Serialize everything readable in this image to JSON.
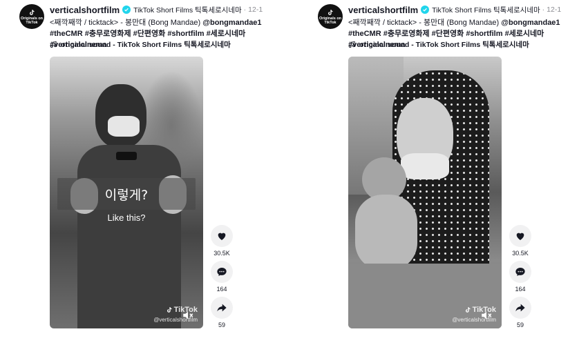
{
  "posts": [
    {
      "avatar_text": "Originals on TikTok",
      "username": "verticalshortfilm",
      "nickname": "TikTok Short Films 틱톡세로시네마",
      "date": "12-1",
      "desc_parts": [
        {
          "text": "<째깍째깍 / ticktack> - 봉만대 (Bong Mandae) ",
          "type": "plain"
        },
        {
          "text": "@bongmandae1",
          "type": "tag"
        },
        {
          "text": " ",
          "type": "plain"
        },
        {
          "text": "#theCMR",
          "type": "tag"
        },
        {
          "text": " ",
          "type": "plain"
        },
        {
          "text": "#충무로영화제",
          "type": "tag"
        },
        {
          "text": " ",
          "type": "plain"
        },
        {
          "text": "#단편영화",
          "type": "tag"
        },
        {
          "text": " ",
          "type": "plain"
        },
        {
          "text": "#shortfilm",
          "type": "tag"
        },
        {
          "text": " ",
          "type": "plain"
        },
        {
          "text": "#세로시네마",
          "type": "tag"
        },
        {
          "text": " ",
          "type": "plain"
        },
        {
          "text": "#verticalcinema",
          "type": "tag"
        }
      ],
      "music": "original sound - TikTok Short Films 틱톡세로시네마",
      "overlay_korean": "이렇게?",
      "overlay_english": "Like this?",
      "watermark_brand": "TikTok",
      "watermark_handle": "@verticalshortfilm",
      "likes": "30.5K",
      "comments": "164",
      "shares": "59"
    },
    {
      "avatar_text": "Originals on TikTok",
      "username": "verticalshortfilm",
      "nickname": "TikTok Short Films 틱톡세로시네마",
      "date": "12-1",
      "desc_parts": [
        {
          "text": "<째깍째깍 / ticktack> - 봉만대 (Bong Mandae) ",
          "type": "plain"
        },
        {
          "text": "@bongmandae1",
          "type": "tag"
        },
        {
          "text": " ",
          "type": "plain"
        },
        {
          "text": "#theCMR",
          "type": "tag"
        },
        {
          "text": " ",
          "type": "plain"
        },
        {
          "text": "#충무로영화제",
          "type": "tag"
        },
        {
          "text": " ",
          "type": "plain"
        },
        {
          "text": "#단편영화",
          "type": "tag"
        },
        {
          "text": " ",
          "type": "plain"
        },
        {
          "text": "#shortfilm",
          "type": "tag"
        },
        {
          "text": " ",
          "type": "plain"
        },
        {
          "text": "#세로시네마",
          "type": "tag"
        },
        {
          "text": " ",
          "type": "plain"
        },
        {
          "text": "#verticalcinema",
          "type": "tag"
        }
      ],
      "music": "original sound - TikTok Short Films 틱톡세로시네마",
      "watermark_brand": "TikTok",
      "watermark_handle": "@verticalshortfilm",
      "likes": "30.5K",
      "comments": "164",
      "shares": "59"
    }
  ],
  "icons": {
    "verified": "verified-badge-icon",
    "music": "music-note-icon",
    "like": "heart-icon",
    "comment": "comment-icon",
    "share": "share-icon",
    "mute": "mute-icon",
    "tiktok": "tiktok-logo-icon"
  },
  "colors": {
    "verified": "#20d5ec",
    "text": "#161823",
    "muted": "#8a8b91",
    "action_bg": "#f1f1f2"
  }
}
